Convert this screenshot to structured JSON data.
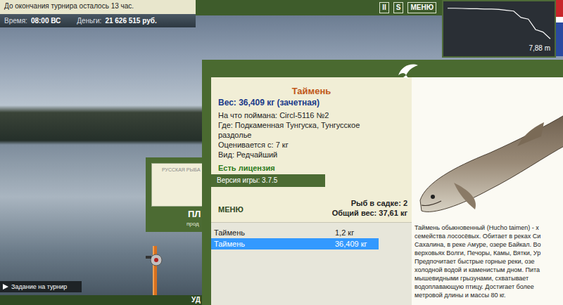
{
  "tournament_panel": {
    "notice": "До окончания турнира осталось 13 час.",
    "time_label": "Время:",
    "time": "08:00 ВС",
    "money_label": "Деньги:",
    "money": "21 626 515 руб."
  },
  "toolbar": {
    "buttons": [
      "II",
      "S",
      "МЕНЮ"
    ]
  },
  "depth_chart": {
    "depths": [
      0.3,
      0.3,
      0.35,
      0.4,
      0.4,
      0.5,
      0.5,
      0.6,
      0.8,
      1.0,
      2.6,
      3.0,
      5.6,
      6.2,
      7.88
    ],
    "reading": "7,88 m"
  },
  "back_window": {
    "label": "РУССКАЯ РЫБА",
    "title": "ПЛ",
    "subtitle": "прод"
  },
  "task_button": {
    "label": "Задание на турнир"
  },
  "bottom_bar": {
    "label": "УД"
  },
  "catch_dialog": {
    "fish_name": "Таймень",
    "weight": "Вес: 36,409 кг (зачетная)",
    "details": [
      "На что поймана: Circl-5116 №2",
      "Где: Подкаменная Тунгуска, Тунгусское раздолье",
      "Оценивается с: 7 кг",
      "Вид: Редчайший"
    ],
    "license": "Есть лицензия",
    "version": "Версия игры: 3.7.5",
    "menu_button": "МЕНЮ",
    "keepnet_count": "Рыб в садке: 2",
    "total_weight": "Общий вес: 37,61 кг",
    "catches": [
      {
        "name": "Таймень",
        "weight": "1,2 кг",
        "selected": false
      },
      {
        "name": "Таймень",
        "weight": "36,409 кг",
        "selected": true
      }
    ],
    "description": [
      "Таймень обыкновенный (Hucho taimen) - х",
      "семейства лососёвых. Обитает в реках Си",
      "Сахалина, в реке Амуре, озере Байкал. Во",
      "верховьях Волги, Печоры, Камы, Вятки, Ур",
      "Предпочитает быстрые горные реки, озе",
      "холодной водой и каменистым дном. Пита",
      "мышевидными грызунами, схватывает",
      "водоплавающую птицу. Достигает более",
      "метровой длины и массы 80 кг."
    ]
  }
}
